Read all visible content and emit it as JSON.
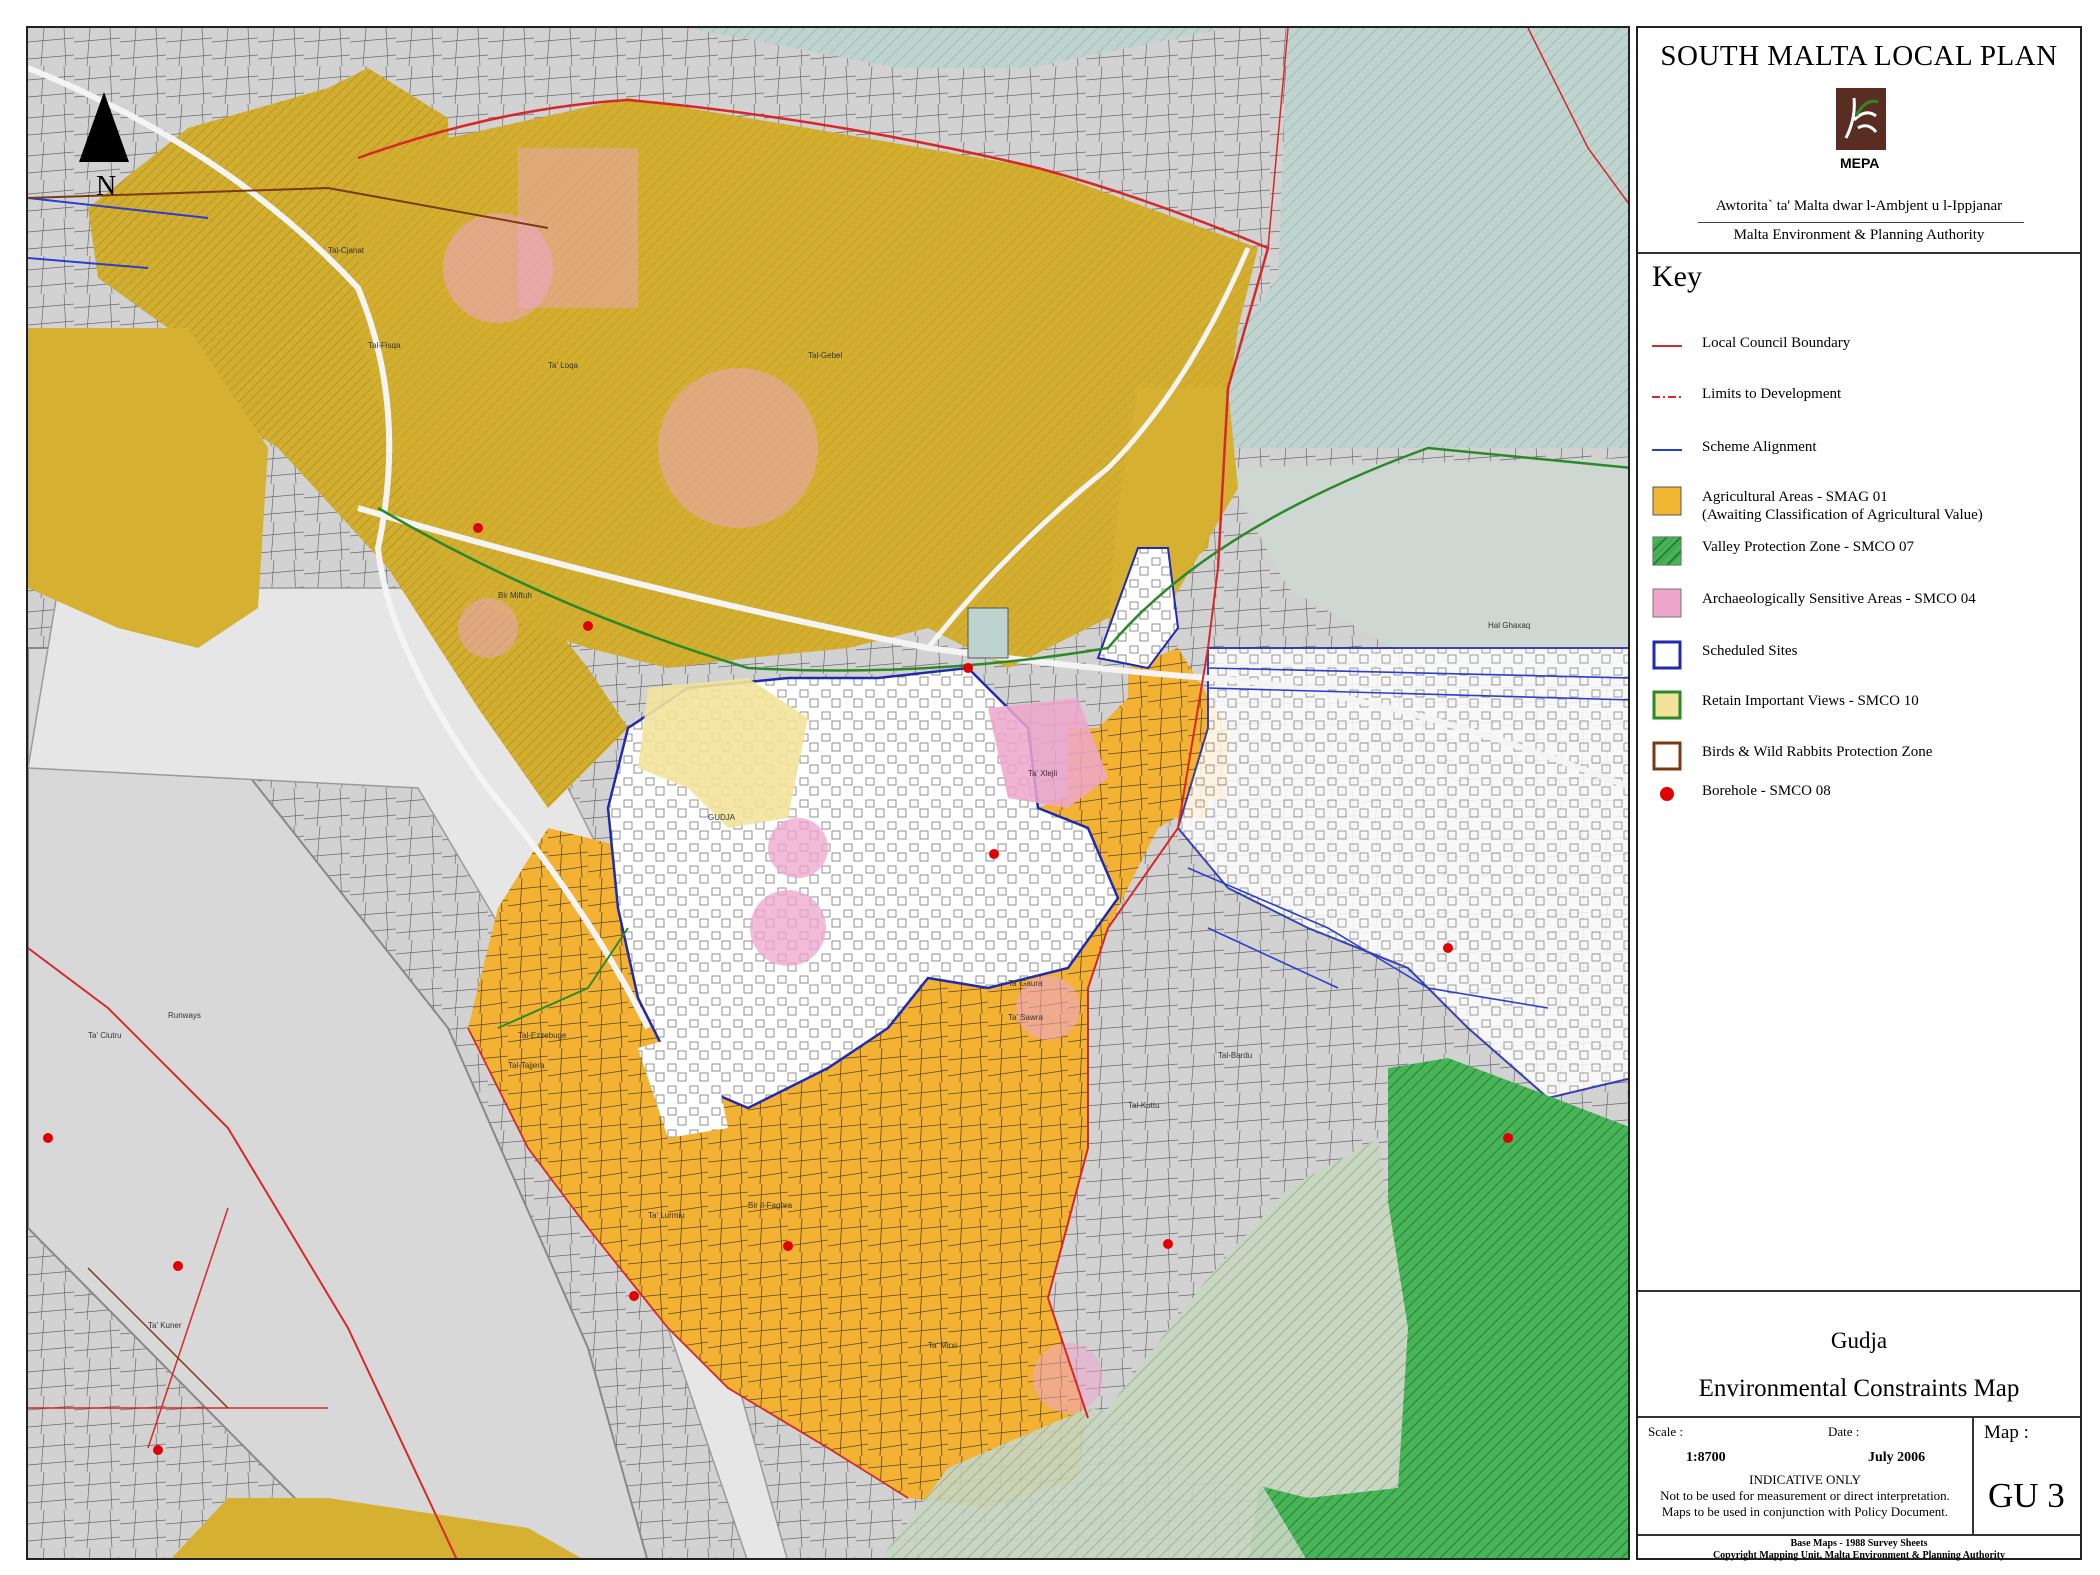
{
  "map": {
    "north_label": "N",
    "place_labels": [
      "GUDJA",
      "Tal-Cjanat",
      "Ta' Loqa",
      "Tal-Fisqa",
      "Tal-Gebel",
      "Bir Miftuh",
      "Ta' Sawra",
      "Ta' Xlejli",
      "Ta' Gaura",
      "Tal-Ezzebuge",
      "Tal-Tajjera",
      "Ta' Lurmiu",
      "Bir Il-Faghra",
      "Ta' Mirxi",
      "Tal-Bardu",
      "Ta' Kuner",
      "Runways",
      "Ta' Ciutru",
      "Tal-Kuttu",
      "Hal Ghaxaq"
    ],
    "colors": {
      "background": "#cfcfcf",
      "agricultural": "#f2b632",
      "agricultural_dark": "#c9a73a",
      "valley_protection": "#3fae4e",
      "archaeological": "#eea6cc",
      "scheduled": "#1f2ab0",
      "important_views": "#f3e39a",
      "boundary": "#d62828",
      "borehole": "#e00000",
      "blue_green": "#a9c9c2"
    }
  },
  "panel": {
    "plan_title": "SOUTH MALTA LOCAL PLAN",
    "logo_text": "MEPA",
    "authority_mt": "Awtorita` ta' Malta dwar l-Ambjent u l-Ippjanar",
    "authority_en": "Malta Environment & Planning Authority",
    "key_title": "Key",
    "key_items": [
      {
        "label": "Local Council Boundary",
        "symbol": "line-red"
      },
      {
        "label": "Limits to Development",
        "symbol": "line-dashdot-red"
      },
      {
        "label": "Scheme Alignment",
        "symbol": "line-blue"
      },
      {
        "label": "Agricultural Areas - SMAG 01",
        "label2": "(Awaiting Classification of Agricultural Value)",
        "symbol": "fill-orange"
      },
      {
        "label": "Valley Protection Zone - SMCO 07",
        "symbol": "hatch-green"
      },
      {
        "label": "Archaeologically Sensitive Areas - SMCO 04",
        "symbol": "fill-pink"
      },
      {
        "label": "Scheduled Sites",
        "symbol": "box-blue"
      },
      {
        "label": "Retain Important Views - SMCO 10",
        "symbol": "box-green-yellow"
      },
      {
        "label": "Birds & Wild Rabbits Protection Zone",
        "symbol": "box-brown"
      },
      {
        "label": "Borehole - SMCO 08",
        "symbol": "dot-red"
      }
    ],
    "locality": "Gudja",
    "map_title": "Environmental Constraints Map",
    "scale_label": "Scale :",
    "scale_value": "1:8700",
    "date_label": "Date :",
    "date_value": "July 2006",
    "map_label": "Map :",
    "map_number": "GU 3",
    "indicative": "INDICATIVE ONLY",
    "disclaimer1": "Not to be used for measurement or direct interpretation.",
    "disclaimer2": "Maps to be used in conjunction with Policy Document.",
    "base_maps": "Base Maps - 1988 Survey Sheets",
    "copyright": "Copyright Mapping Unit, Malta Environment & Planning Authority"
  }
}
